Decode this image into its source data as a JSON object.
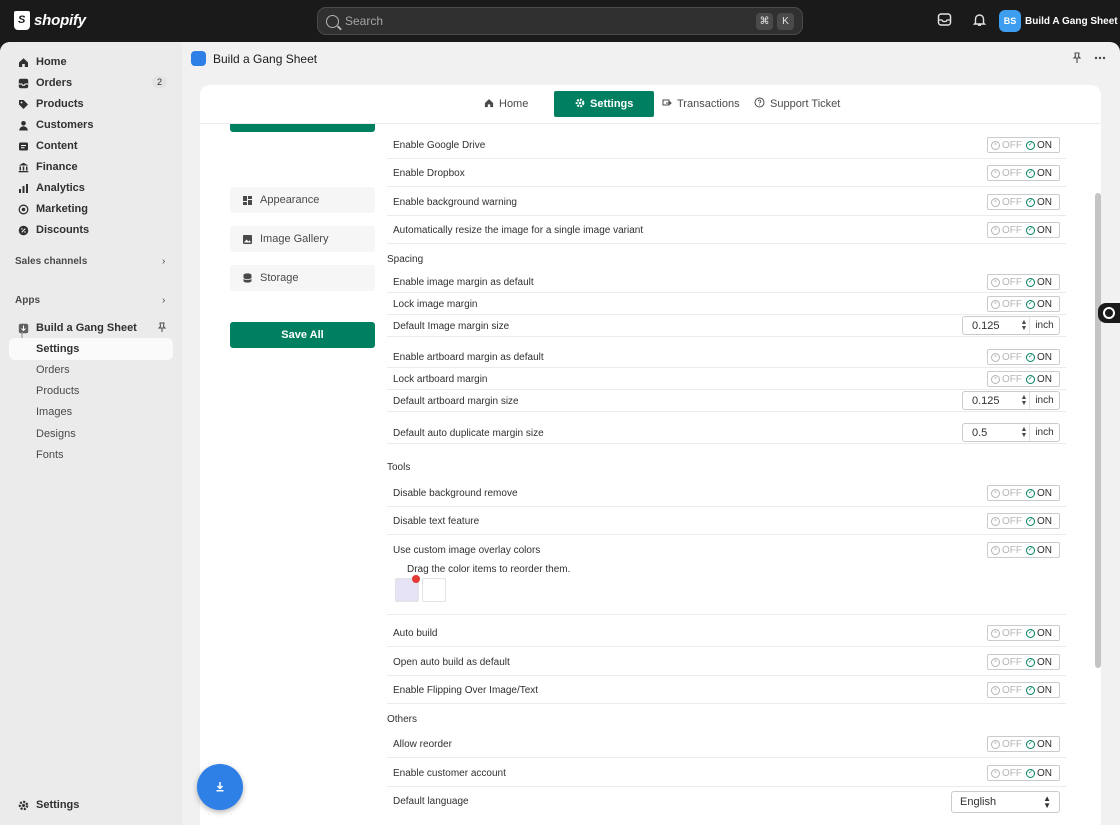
{
  "topbar": {
    "brand": "shopify",
    "search_placeholder": "Search",
    "shortcut_keys": [
      "⌘",
      "K"
    ],
    "store_initials": "BS",
    "store_name": "Build A Gang Sheet"
  },
  "sidebar": {
    "items": [
      {
        "label": "Home",
        "icon": "home-icon"
      },
      {
        "label": "Orders",
        "icon": "orders-icon",
        "badge": "2"
      },
      {
        "label": "Products",
        "icon": "tag-icon"
      },
      {
        "label": "Customers",
        "icon": "person-icon"
      },
      {
        "label": "Content",
        "icon": "content-icon"
      },
      {
        "label": "Finance",
        "icon": "bank-icon"
      },
      {
        "label": "Analytics",
        "icon": "chart-icon"
      },
      {
        "label": "Marketing",
        "icon": "target-icon"
      },
      {
        "label": "Discounts",
        "icon": "discount-icon"
      }
    ],
    "sales_channels_label": "Sales channels",
    "apps_label": "Apps",
    "app_name": "Build a Gang Sheet",
    "app_sub_items": [
      "Settings",
      "Orders",
      "Products",
      "Images",
      "Designs",
      "Fonts"
    ],
    "settings_label": "Settings"
  },
  "app_header": {
    "title": "Build a Gang Sheet"
  },
  "tabs": [
    {
      "label": "Home"
    },
    {
      "label": "Settings"
    },
    {
      "label": "Transactions"
    },
    {
      "label": "Support Ticket"
    }
  ],
  "left_menu": {
    "items": [
      "Appearance",
      "Image Gallery",
      "Storage"
    ],
    "save_label": "Save All"
  },
  "toggle": {
    "off": "OFF",
    "on": "ON"
  },
  "settings": {
    "top_rows": [
      "Enable Google Drive",
      "Enable Dropbox",
      "Enable background warning",
      "Automatically resize the image for a single image variant"
    ],
    "spacing_title": "Spacing",
    "spacing_rows": [
      {
        "label": "Enable image margin as default",
        "type": "toggle"
      },
      {
        "label": "Lock image margin",
        "type": "toggle"
      },
      {
        "label": "Default Image margin size",
        "type": "number",
        "value": "0.125",
        "unit": "inch"
      },
      {
        "label": "Enable artboard margin as default",
        "type": "toggle"
      },
      {
        "label": "Lock artboard margin",
        "type": "toggle"
      },
      {
        "label": "Default artboard margin size",
        "type": "number",
        "value": "0.125",
        "unit": "inch"
      },
      {
        "label": "Default auto duplicate margin size",
        "type": "number",
        "value": "0.5",
        "unit": "inch"
      }
    ],
    "tools_title": "Tools",
    "tools_rows": [
      "Disable background remove",
      "Disable text feature",
      "Use custom image overlay colors"
    ],
    "drag_note": "Drag the color items to reorder them.",
    "swatch_colors": [
      "#e6e3f7",
      "#ffffff"
    ],
    "build_rows": [
      "Auto build",
      "Open auto build as default",
      "Enable Flipping Over Image/Text"
    ],
    "others_title": "Others",
    "others_rows": [
      "Allow reorder",
      "Enable customer account"
    ],
    "language_label": "Default language",
    "language_value": "English"
  },
  "colors": {
    "accent": "#008060",
    "app_blue": "#2e7fe6"
  }
}
